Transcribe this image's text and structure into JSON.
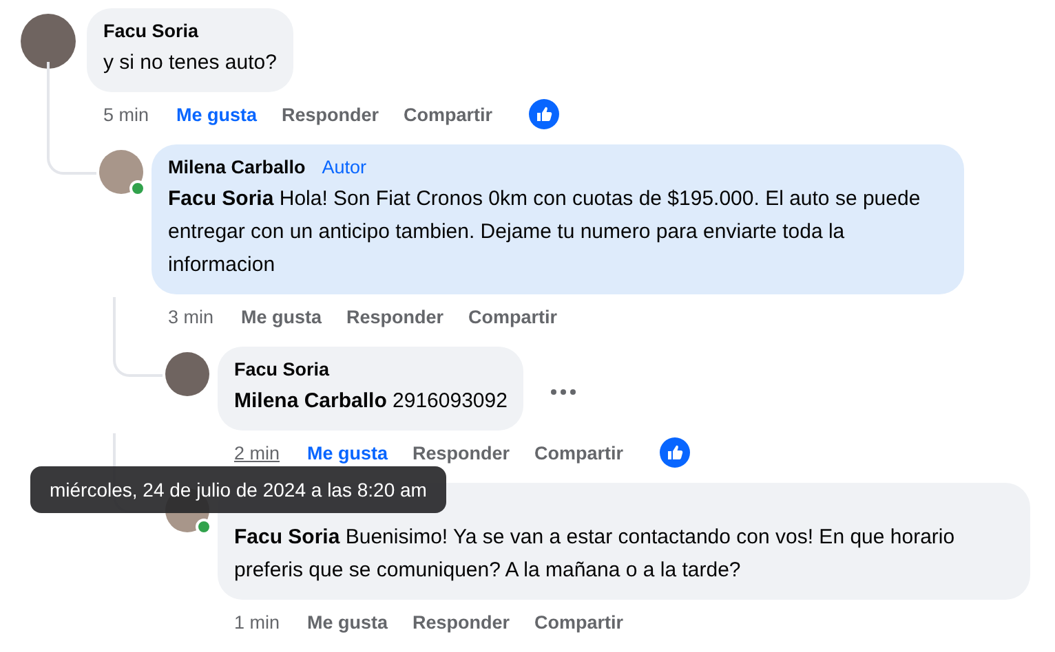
{
  "comments": [
    {
      "author": "Facu Soria",
      "text": "y si no tenes auto?",
      "time": "5 min",
      "time_hovered": false,
      "liked": true,
      "reacted": true,
      "online": false,
      "highlighted": false,
      "actions": [
        "Me gusta",
        "Responder",
        "Compartir"
      ],
      "children": [
        {
          "author": "Milena Carballo",
          "badge": "Autor",
          "text": "**Facu Soria** Hola! Son Fiat Cronos 0km con cuotas de $195.000. El auto se puede entregar con un anticipo tambien. Dejame tu numero para enviarte toda la informacion",
          "time": "3 min",
          "time_hovered": false,
          "liked": false,
          "online": true,
          "highlighted": true,
          "actions": [
            "Me gusta",
            "Responder",
            "Compartir"
          ],
          "children": [
            {
              "author": "Facu Soria",
              "text": "**Milena Carballo** 2916093092",
              "time": "2 min",
              "time_hovered": true,
              "liked": true,
              "reacted": true,
              "more_menu": true,
              "online": false,
              "highlighted": false,
              "actions": [
                "Me gusta",
                "Responder",
                "Compartir"
              ]
            },
            {
              "text": "**Facu Soria** Buenisimo! Ya se van a estar contactando con vos! En que horario preferis que se comuniquen? A la mañana o a la tarde?",
              "time": "1 min",
              "time_hovered": false,
              "liked": false,
              "online": true,
              "highlighted": false,
              "actions": [
                "Me gusta",
                "Responder",
                "Compartir"
              ]
            }
          ]
        }
      ]
    }
  ],
  "tooltip": {
    "text": "miércoles, 24 de julio de 2024 a las 8:20 am"
  }
}
